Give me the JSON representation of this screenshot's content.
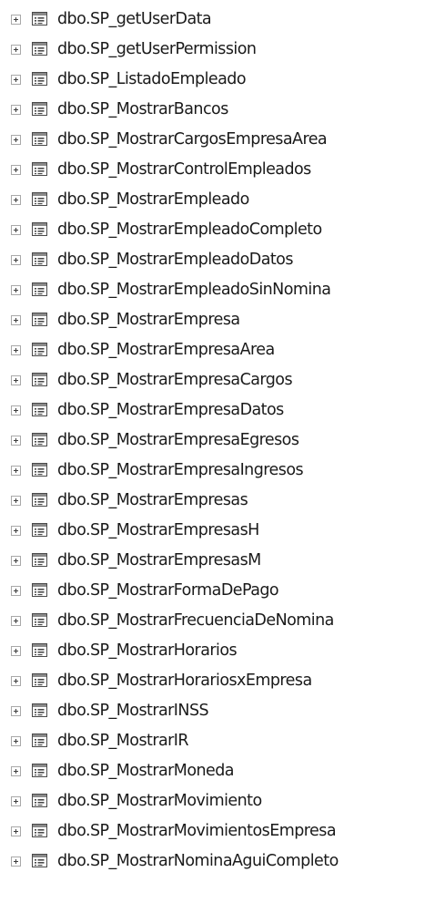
{
  "object_explorer": {
    "node_icon": "stored-procedure-icon",
    "expand_icon": "expand-plus-icon",
    "items": [
      "dbo.SP_getUserData",
      "dbo.SP_getUserPermission",
      "dbo.SP_ListadoEmpleado",
      "dbo.SP_MostrarBancos",
      "dbo.SP_MostrarCargosEmpresaArea",
      "dbo.SP_MostrarControlEmpleados",
      "dbo.SP_MostrarEmpleado",
      "dbo.SP_MostrarEmpleadoCompleto",
      "dbo.SP_MostrarEmpleadoDatos",
      "dbo.SP_MostrarEmpleadoSinNomina",
      "dbo.SP_MostrarEmpresa",
      "dbo.SP_MostrarEmpresaArea",
      "dbo.SP_MostrarEmpresaCargos",
      "dbo.SP_MostrarEmpresaDatos",
      "dbo.SP_MostrarEmpresaEgresos",
      "dbo.SP_MostrarEmpresaIngresos",
      "dbo.SP_MostrarEmpresas",
      "dbo.SP_MostrarEmpresasH",
      "dbo.SP_MostrarEmpresasM",
      "dbo.SP_MostrarFormaDePago",
      "dbo.SP_MostrarFrecuenciaDeNomina",
      "dbo.SP_MostrarHorarios",
      "dbo.SP_MostrarHorariosxEmpresa",
      "dbo.SP_MostrarINSS",
      "dbo.SP_MostrarIR",
      "dbo.SP_MostrarMoneda",
      "dbo.SP_MostrarMovimiento",
      "dbo.SP_MostrarMovimientosEmpresa",
      "dbo.SP_MostrarNominaAguiCompleto"
    ]
  }
}
